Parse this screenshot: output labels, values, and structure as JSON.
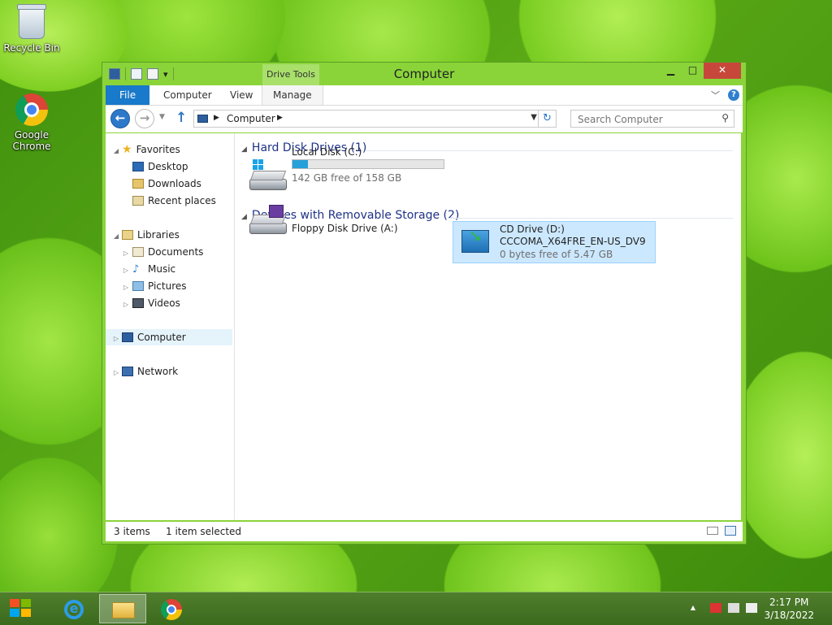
{
  "desktop": {
    "icons": [
      {
        "label": "Recycle Bin"
      },
      {
        "label": "Google Chrome"
      }
    ]
  },
  "window": {
    "title": "Computer",
    "context_tab_group": "Drive Tools",
    "ribbon_tabs": [
      {
        "label": "File"
      },
      {
        "label": "Computer"
      },
      {
        "label": "View"
      },
      {
        "label": "Manage"
      }
    ],
    "address": {
      "crumb": "Computer"
    },
    "search": {
      "placeholder": "Search Computer"
    }
  },
  "nav_pane": {
    "favorites": {
      "label": "Favorites",
      "items": [
        {
          "label": "Desktop"
        },
        {
          "label": "Downloads"
        },
        {
          "label": "Recent places"
        }
      ]
    },
    "libraries": {
      "label": "Libraries",
      "items": [
        {
          "label": "Documents"
        },
        {
          "label": "Music"
        },
        {
          "label": "Pictures"
        },
        {
          "label": "Videos"
        }
      ]
    },
    "computer": {
      "label": "Computer",
      "selected": true
    },
    "network": {
      "label": "Network"
    }
  },
  "content": {
    "groups": [
      {
        "label": "Hard Disk Drives (1)",
        "drives": [
          {
            "name": "Local Disk (C:)",
            "sub": "142 GB free of 158 GB",
            "used_fraction": 0.101
          }
        ]
      },
      {
        "label": "Devices with Removable Storage (2)",
        "drives": [
          {
            "name": "Floppy Disk Drive (A:)"
          },
          {
            "name": "CD Drive (D:)",
            "volume": "CCCOMA_X64FRE_EN-US_DV9",
            "sub": "0 bytes free of 5.47 GB",
            "selected": true
          }
        ]
      }
    ]
  },
  "status": {
    "items": "3 items",
    "selected": "1 item selected"
  },
  "taskbar": {
    "time": "2:17 PM",
    "date": "3/18/2022"
  },
  "colors": {
    "accent": "#1979ca",
    "progress": "#26a0da",
    "selection": "#cce8ff",
    "close": "#c7483a",
    "group_header": "#1e3287"
  }
}
